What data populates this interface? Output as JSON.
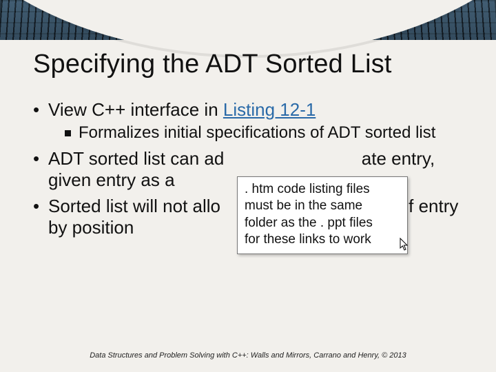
{
  "title": "Specifying the ADT Sorted List",
  "bullets": {
    "b1_pre": "View C++ interface in ",
    "b1_link": "Listing 12-1",
    "b1_sub": "Formalizes initial specifications of ADT sorted list",
    "b2_a": "ADT sorted list can ad",
    "b2_b": "ate entry, given entry as a",
    "b3_a": "Sorted list will not allo",
    "b3_b": "ment of entry by position"
  },
  "tooltip": {
    "l1": ". htm code listing files",
    "l2": "must be in the same",
    "l3": "folder as the . ppt files",
    "l4": "for these links to work"
  },
  "footer": "Data Structures and Problem Solving with C++: Walls and Mirrors, Carrano and Henry, © 2013"
}
